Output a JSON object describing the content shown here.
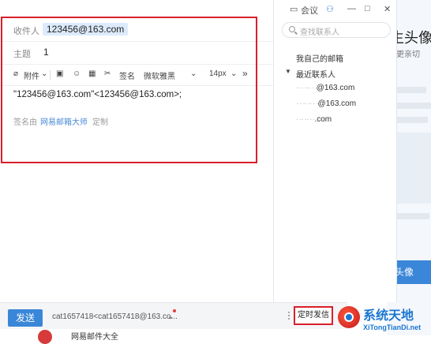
{
  "compose": {
    "to_label": "收件人",
    "to_value": "123456@163.com",
    "subject_label": "主题",
    "subject_value": "1",
    "toolbar": {
      "attachment": "附件",
      "signature": "签名",
      "font_family": "微软雅黑",
      "font_size": "14px",
      "more": "»"
    },
    "body_text": "\"123456@163.com\"<123456@163.com>;",
    "signature_line": {
      "prefix": "签名由",
      "provider": "网易邮箱大师",
      "customize": "定制"
    }
  },
  "bottom_bar": {
    "send_label": "发送",
    "sender": "cat1657418<cat1657418@163.co...",
    "scheduled_send_label": "定时发信"
  },
  "titlebar": {
    "meeting_label": "会议"
  },
  "contacts": {
    "search_placeholder": "查找联系人",
    "my_mailbox": "我自己的邮箱",
    "recent_header": "最近联系人",
    "recent": [
      "@163.com",
      "@163.com",
      ".com"
    ]
  },
  "background": {
    "heading": "生头像",
    "subtext": "更亲切",
    "button": "头像"
  },
  "footer_strip": {
    "text": "网易邮件大全"
  },
  "watermark": {
    "cn": "系统天地",
    "en": "XiTongTianDi.net"
  },
  "colors": {
    "accent": "#3a86d8",
    "highlight": "#d8202b",
    "chip": "#dcebfb"
  }
}
